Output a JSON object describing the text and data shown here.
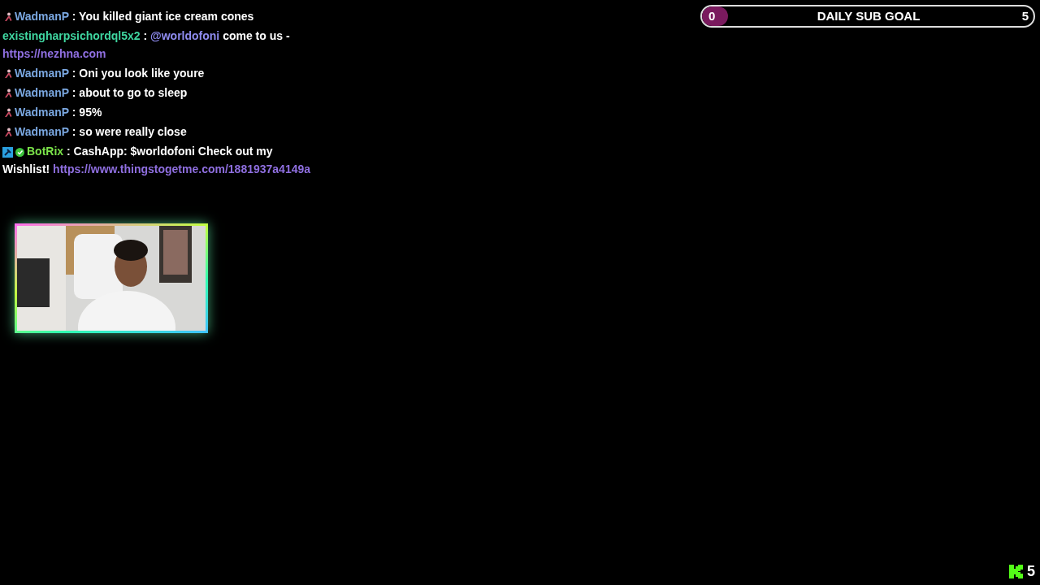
{
  "chat": [
    {
      "badges": [
        {
          "kind": "figure"
        }
      ],
      "user": "WadmanP",
      "color": "#7aa7e0",
      "separator": ":",
      "parts": [
        {
          "kind": "text",
          "text": "You killed giant ice cream cones"
        }
      ]
    },
    {
      "user": "existingharpsichordql5x2",
      "color": "#3fd6a0",
      "separator": ":",
      "parts": [
        {
          "kind": "mention",
          "text": "@worldofoni"
        },
        {
          "kind": "text",
          "text": "come to us -"
        },
        {
          "kind": "link",
          "text": "https://nezhna.com"
        }
      ]
    },
    {
      "badges": [
        {
          "kind": "figure"
        }
      ],
      "user": "WadmanP",
      "color": "#7aa7e0",
      "separator": ":",
      "parts": [
        {
          "kind": "text",
          "text": "Oni you look like youre"
        }
      ]
    },
    {
      "badges": [
        {
          "kind": "figure"
        }
      ],
      "user": "WadmanP",
      "color": "#7aa7e0",
      "separator": ":",
      "parts": [
        {
          "kind": "text",
          "text": "about to go to sleep"
        }
      ]
    },
    {
      "badges": [
        {
          "kind": "figure"
        }
      ],
      "user": "WadmanP",
      "color": "#7aa7e0",
      "separator": ":",
      "parts": [
        {
          "kind": "text",
          "text": "95%"
        }
      ]
    },
    {
      "badges": [
        {
          "kind": "figure"
        }
      ],
      "user": "WadmanP",
      "color": "#7aa7e0",
      "separator": ":",
      "parts": [
        {
          "kind": "text",
          "text": "so were really close"
        }
      ]
    },
    {
      "badges": [
        {
          "kind": "bot"
        },
        {
          "kind": "verified"
        }
      ],
      "user": "BotRix",
      "color": "#7be34a",
      "separator": ":",
      "parts": [
        {
          "kind": "text",
          "text": "CashApp: $worldofoni Check out my"
        },
        {
          "kind": "text",
          "text": "Wishlist!"
        },
        {
          "kind": "link",
          "text": "https://www.thingstogetme.com/1881937a4149a"
        }
      ]
    }
  ],
  "goal": {
    "current": "0",
    "title": "DAILY SUB GOAL",
    "target": "5",
    "level": 0
  },
  "viewers": {
    "count": "5"
  }
}
